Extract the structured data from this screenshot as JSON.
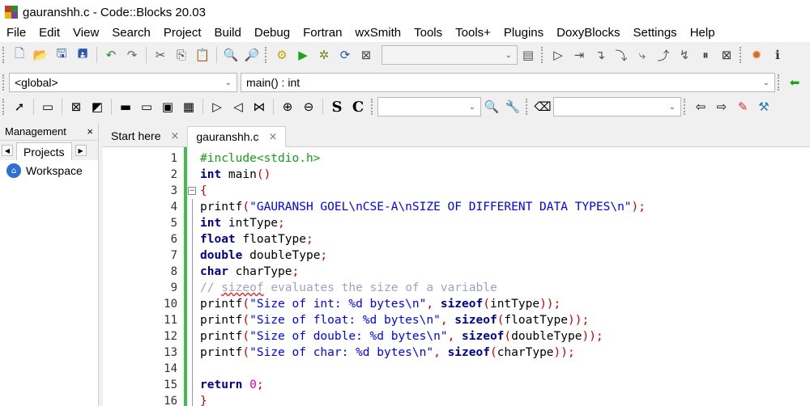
{
  "window": {
    "title": "gauranshh.c - Code::Blocks 20.03"
  },
  "menu": [
    "File",
    "Edit",
    "View",
    "Search",
    "Project",
    "Build",
    "Debug",
    "Fortran",
    "wxSmith",
    "Tools",
    "Tools+",
    "Plugins",
    "DoxyBlocks",
    "Settings",
    "Help"
  ],
  "scope": {
    "global": "<global>",
    "function": "main() : int"
  },
  "management": {
    "title": "Management",
    "close": "×",
    "tab": "Projects",
    "workspace": "Workspace"
  },
  "editor": {
    "tabs": [
      {
        "label": "Start here",
        "close": "×"
      },
      {
        "label": "gauranshh.c",
        "close": "×"
      }
    ],
    "line_numbers": [
      "1",
      "2",
      "3",
      "4",
      "5",
      "6",
      "7",
      "8",
      "9",
      "10",
      "11",
      "12",
      "13",
      "14",
      "15",
      "16"
    ],
    "code": {
      "l1": "#include<stdio.h>",
      "l2_kw": "int",
      "l2_rest": " main",
      "l2_op": "()",
      "l3": "{",
      "l4_a": "printf",
      "l4_b": "(",
      "l4_s": "\"GAURANSH GOEL\\nCSE-A\\nSIZE OF DIFFERENT DATA TYPES\\n\"",
      "l4_c": ");",
      "l5_kw": "int",
      "l5_rest": " intType",
      "l5_op": ";",
      "l6_kw": "float",
      "l6_rest": " floatType",
      "l6_op": ";",
      "l7_kw": "double",
      "l7_rest": " doubleType",
      "l7_op": ";",
      "l8_kw": "char",
      "l8_rest": " charType",
      "l8_op": ";",
      "l9_a": "// ",
      "l9_b": "sizeof",
      "l9_c": " evaluates the size of a variable",
      "l10_s": "\"Size of int: %d bytes\\n\"",
      "l10_arg": "intType",
      "l11_s": "\"Size of float: %d bytes\\n\"",
      "l11_arg": "floatType",
      "l12_s": "\"Size of double: %d bytes\\n\"",
      "l12_arg": "doubleType",
      "l13_s": "\"Size of char: %d bytes\\n\"",
      "l13_arg": "charType",
      "printf": "printf",
      "open": "(",
      "comma": ", ",
      "sizeof": "sizeof",
      "closeall": "));",
      "l15_kw": "return",
      "l15_num": "0",
      "l15_op": ";",
      "l15_sp": " ",
      "l16": "}"
    }
  }
}
